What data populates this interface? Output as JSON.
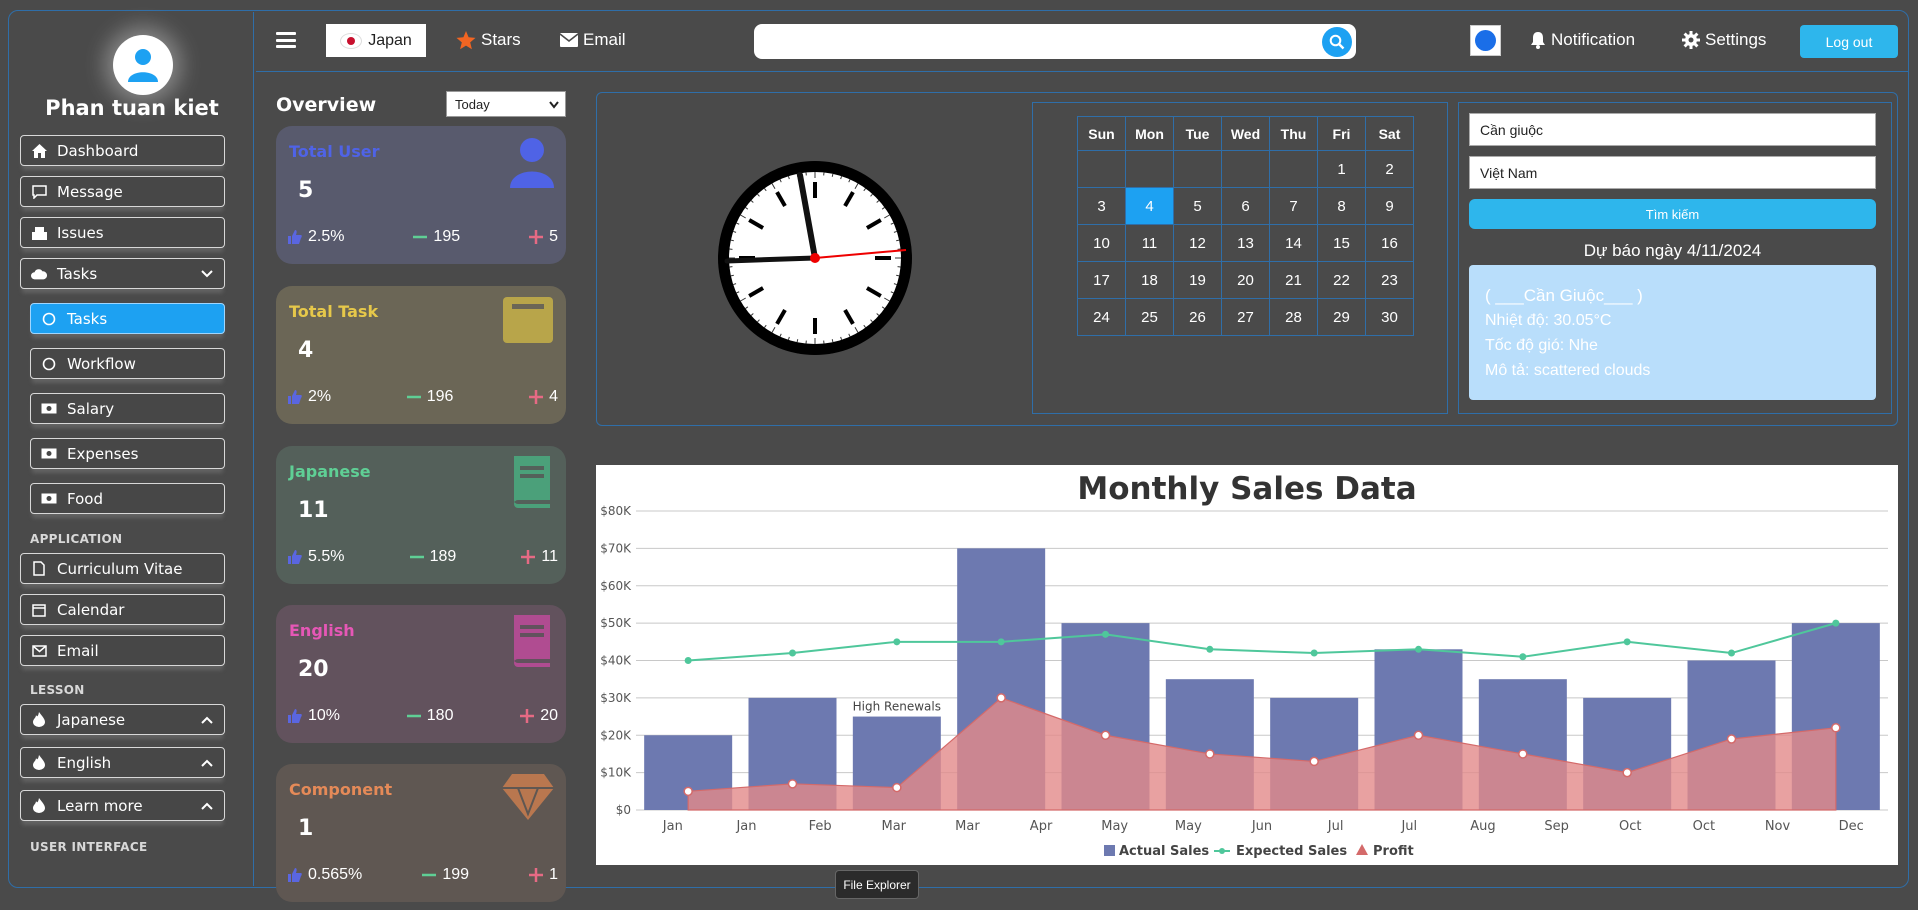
{
  "user": {
    "name": "Phan tuan kiet"
  },
  "sidebar": {
    "items": [
      {
        "label": "Dashboard",
        "icon": "home-icon"
      },
      {
        "label": "Message",
        "icon": "message-icon"
      },
      {
        "label": "Issues",
        "icon": "issues-icon"
      },
      {
        "label": "Tasks",
        "icon": "cloud-icon"
      }
    ],
    "tasks_sub": [
      {
        "label": "Tasks"
      },
      {
        "label": "Workflow"
      },
      {
        "label": "Salary"
      },
      {
        "label": "Expenses"
      },
      {
        "label": "Food"
      }
    ],
    "section_application": "APPLICATION",
    "application_items": [
      {
        "label": "Curriculum Vitae"
      },
      {
        "label": "Calendar"
      },
      {
        "label": "Email"
      }
    ],
    "section_lesson": "LESSON",
    "lesson_items": [
      {
        "label": "Japanese"
      },
      {
        "label": "English"
      },
      {
        "label": "Learn more"
      }
    ],
    "section_ui": "USER INTERFACE"
  },
  "topbar": {
    "language": "Japan",
    "stars": "Stars",
    "email": "Email",
    "search_value": "",
    "notification": "Notification",
    "settings": "Settings",
    "logout": "Log out",
    "theme_color": "#1a6ee8"
  },
  "overview": {
    "title": "Overview",
    "period": "Today",
    "cards": [
      {
        "title": "Total User",
        "value": "5",
        "percent": "2.5%",
        "minus": "195",
        "plus": "5",
        "color": "#4f63e6"
      },
      {
        "title": "Total Task",
        "value": "4",
        "percent": "2%",
        "minus": "196",
        "plus": "4",
        "color": "#e6c84a"
      },
      {
        "title": "Japanese",
        "value": "11",
        "percent": "5.5%",
        "minus": "189",
        "plus": "11",
        "color": "#5fcf95"
      },
      {
        "title": "English",
        "value": "20",
        "percent": "10%",
        "minus": "180",
        "plus": "20",
        "color": "#e657b6"
      },
      {
        "title": "Component",
        "value": "1",
        "percent": "0.565%",
        "minus": "199",
        "plus": "1",
        "color": "#e58a58"
      }
    ]
  },
  "calendar": {
    "headers": [
      "Sun",
      "Mon",
      "Tue",
      "Wed",
      "Thu",
      "Fri",
      "Sat"
    ],
    "weeks": [
      [
        "",
        "",
        "",
        "",
        "",
        "1",
        "2"
      ],
      [
        "3",
        "4",
        "5",
        "6",
        "7",
        "8",
        "9"
      ],
      [
        "10",
        "11",
        "12",
        "13",
        "14",
        "15",
        "16"
      ],
      [
        "17",
        "18",
        "19",
        "20",
        "21",
        "22",
        "23"
      ],
      [
        "24",
        "25",
        "26",
        "27",
        "28",
        "29",
        "30"
      ]
    ],
    "today": "4"
  },
  "weather": {
    "city": "Cần giuộc",
    "country": "Việt Nam",
    "button": "Tìm kiếm",
    "title": "Dự báo ngày 4/11/2024",
    "location": "( ___Cần Giuộc___ )",
    "temperature": "Nhiệt độ: 30.05°C",
    "wind": "Tốc độ gió: Nhe",
    "description": "Mô tả: scattered clouds"
  },
  "chart_data": {
    "type": "bar",
    "title": "Monthly Sales Data",
    "categories": [
      "Jan",
      "Jan",
      "Feb",
      "Mar",
      "Mar",
      "Apr",
      "May",
      "May",
      "Jun",
      "Jul",
      "Jul",
      "Aug",
      "Sep",
      "Oct",
      "Oct",
      "Nov",
      "Dec"
    ],
    "bar_categories": [
      "Jan",
      "Feb",
      "Mar",
      "Apr",
      "May",
      "Jun",
      "Jul",
      "Aug",
      "Sep",
      "Oct",
      "Nov",
      "Dec"
    ],
    "yticks": [
      "$0",
      "$10K",
      "$20K",
      "$30K",
      "$40K",
      "$50K",
      "$60K",
      "$70K",
      "$80K"
    ],
    "ylim": [
      0,
      80000
    ],
    "series": [
      {
        "name": "Actual Sales",
        "type": "bar",
        "color": "#6d79b0",
        "values": [
          20000,
          30000,
          25000,
          70000,
          50000,
          35000,
          30000,
          43000,
          35000,
          30000,
          40000,
          50000
        ]
      },
      {
        "name": "Expected Sales",
        "type": "line",
        "color": "#4fc79b",
        "values": [
          40000,
          42000,
          45000,
          45000,
          47000,
          43000,
          42000,
          43000,
          41000,
          45000,
          42000,
          50000
        ]
      },
      {
        "name": "Profit",
        "type": "area",
        "color": "#e28a8a",
        "values": [
          5000,
          7000,
          6000,
          30000,
          20000,
          15000,
          13000,
          20000,
          15000,
          10000,
          19000,
          22000
        ]
      }
    ],
    "annotation": {
      "label": "High Renewals",
      "category": "Mar"
    },
    "grid": true,
    "legend": "bottom"
  },
  "tooltip": {
    "text": "File Explorer"
  }
}
